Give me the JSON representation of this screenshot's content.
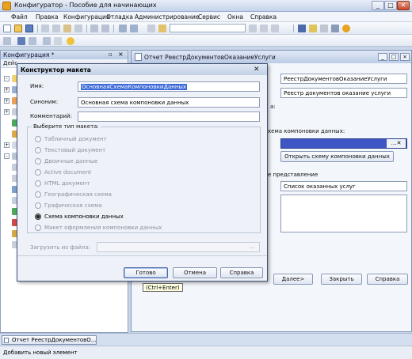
{
  "window": {
    "title": "Конфигуратор - Пособие для начинающих"
  },
  "menu": [
    "Файл",
    "Правка",
    "Конфигурация",
    "Отладка",
    "Администрирование",
    "Сервис",
    "Окна",
    "Справка"
  ],
  "config_panel": {
    "title": "Конфигурация *",
    "toolbar_text": "Дейс"
  },
  "doc_window": {
    "title": "Отчет РеестрДокументовОказаниеУслуги",
    "name_value": "РеестрДокументовОказаниеУслуги",
    "synonym_value": "Реестр документов оказание услуги",
    "label_a": "а:",
    "label_schema": "хема компоновки данных:",
    "open_schema_button": "Открыть схему компоновки данных",
    "label_extended": "е представление",
    "extended_value": "Список оказанных услуг",
    "next_button": "Далее>",
    "close_button": "Закрыть",
    "help_button": "Справка"
  },
  "dialog": {
    "title": "Конструктор макета",
    "close_symbol": "✕",
    "name_label": "Имя:",
    "name_value": "ОсновнаяСхемаКомпоновкиДанных",
    "synonym_label": "Синоним:",
    "synonym_value": "Основная схема компоновки данных",
    "comment_label": "Комментарий:",
    "comment_value": "",
    "type_group_title": "Выберите тип макета:",
    "types": [
      {
        "label": "Табличный документ",
        "selected": false
      },
      {
        "label": "Текстовый документ",
        "selected": false
      },
      {
        "label": "Двоичные данные",
        "selected": false
      },
      {
        "label": "Active document",
        "selected": false
      },
      {
        "label": "HTML документ",
        "selected": false
      },
      {
        "label": "Географическая схема",
        "selected": false
      },
      {
        "label": "Графическая схема",
        "selected": false
      },
      {
        "label": "Схема компоновки данных",
        "selected": true
      },
      {
        "label": "Макет оформления компоновки данных",
        "selected": false
      }
    ],
    "load_label": "Загрузить из файла:",
    "load_value": "",
    "ok_button": "Готово",
    "cancel_button": "Отмена",
    "help_button": "Справка",
    "tooltip": "(Ctrl+Enter)"
  },
  "taskbar": {
    "item": "Отчет РеестрДокументовО..."
  },
  "status": {
    "text": "Добавить новый элемент"
  }
}
